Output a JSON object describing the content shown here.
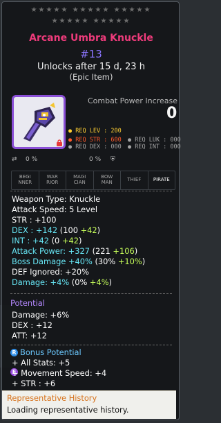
{
  "stars": {
    "row1": "★★★★★ ★★★★★ ★★★★★",
    "row2": "★★★★★ ★★★★★"
  },
  "item": {
    "name": "Arcane Umbra Knuckle",
    "number": "#13",
    "unlock": "Unlocks after 15 d, 23 h",
    "grade": "(Epic Item)"
  },
  "combat": {
    "label": "Combat Power Increase",
    "value": "0"
  },
  "requirements": {
    "lev": "● REQ LEV : 200",
    "str": "● REQ STR : 600",
    "luk": "● REQ LUK : 000",
    "dex": "● REQ DEX : 000",
    "int": "● REQ INT : 000"
  },
  "mini": {
    "pct1": "0 %",
    "pct2": "0 %"
  },
  "jobs": [
    {
      "line1": "BEGI",
      "line2": "NNER"
    },
    {
      "line1": "WAR",
      "line2": "RIOR"
    },
    {
      "line1": "MAGI",
      "line2": "CIAN"
    },
    {
      "line1": "BOW",
      "line2": "MAN"
    },
    {
      "line1": "THIEF",
      "line2": ""
    },
    {
      "line1": "PIRATE",
      "line2": ""
    }
  ],
  "stats": {
    "weapon_type": "Weapon Type: Knuckle",
    "attack_speed": "Attack Speed: 5 Level",
    "str": "STR : +100",
    "dex_main": "DEX : +142",
    "dex_base": " (100 ",
    "dex_bonus": "+42",
    "dex_close": ")",
    "int_main": "INT : +42",
    "int_base": " (0 ",
    "int_bonus": "+42",
    "int_close": ")",
    "atk_main": "Attack Power: +327",
    "atk_base": " (221 ",
    "atk_bonus": "+106",
    "atk_close": ")",
    "boss_main": "Boss Damage +40%",
    "boss_base": " (30% ",
    "boss_bonus": "+10%",
    "boss_close": ")",
    "def_ignored": "DEF Ignored: +20%",
    "dmg_main": "Damage: +4%",
    "dmg_base": " (0% ",
    "dmg_bonus": "+4%",
    "dmg_close": ")"
  },
  "potential": {
    "badge": "E",
    "title": "Potential",
    "lines": [
      "Damage: +6%",
      "DEX : +12",
      "ATT: +12"
    ]
  },
  "bonus_potential": {
    "badge": "R",
    "title": "Bonus Potential",
    "lines": [
      "+ All Stats: +5",
      "+ Movement Speed: +4",
      "+ STR : +6"
    ]
  },
  "representative": {
    "title": "Representative History",
    "text": "Loading representative history."
  },
  "colors": {
    "title": "#ee3b7b",
    "number": "#8b75ff",
    "stat_cyan": "#67e6f5",
    "bonus_green": "#c7ff5a",
    "req_lev": "#ffcf33",
    "req_str": "#ff5a2b",
    "frame_epic": "#8a4fd6"
  }
}
